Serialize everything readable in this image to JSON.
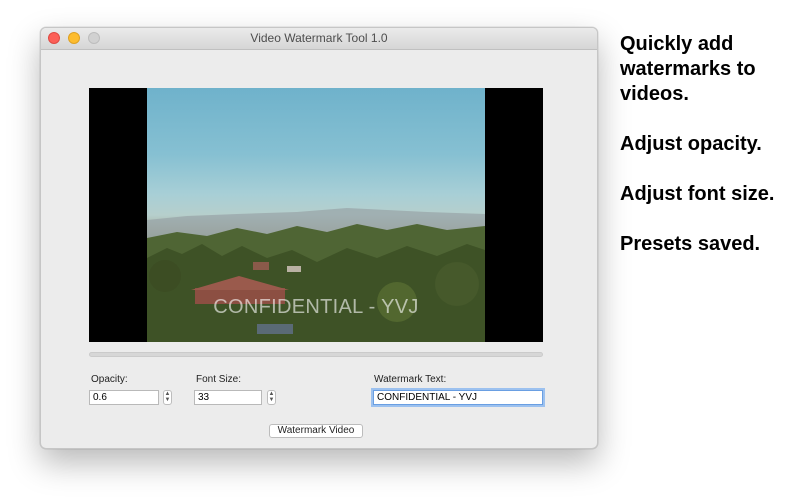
{
  "window": {
    "title": "Video Watermark Tool 1.0",
    "traffic_lights": [
      "close",
      "minimize",
      "zoom"
    ]
  },
  "preview": {
    "watermark_overlay_text": "CONFIDENTIAL - YVJ",
    "progress": 0
  },
  "controls": {
    "opacity_label": "Opacity:",
    "opacity_value": "0.6",
    "font_size_label": "Font Size:",
    "font_size_value": "33",
    "watermark_text_label": "Watermark Text:",
    "watermark_text_value": "CONFIDENTIAL - YVJ",
    "stepper_up_icon": "chevron-up-icon",
    "stepper_down_icon": "chevron-down-icon"
  },
  "actions": {
    "watermark_button_label": "Watermark Video"
  },
  "marketing": {
    "line1": "Quickly add watermarks to videos.",
    "line2": "Adjust opacity.",
    "line3": "Adjust font size.",
    "line4": "Presets saved."
  },
  "colors": {
    "close": "#fc5f57",
    "minimize": "#fdbc2e",
    "zoom": "#d1d1d1",
    "focus_ring": "#9cc1ef"
  }
}
